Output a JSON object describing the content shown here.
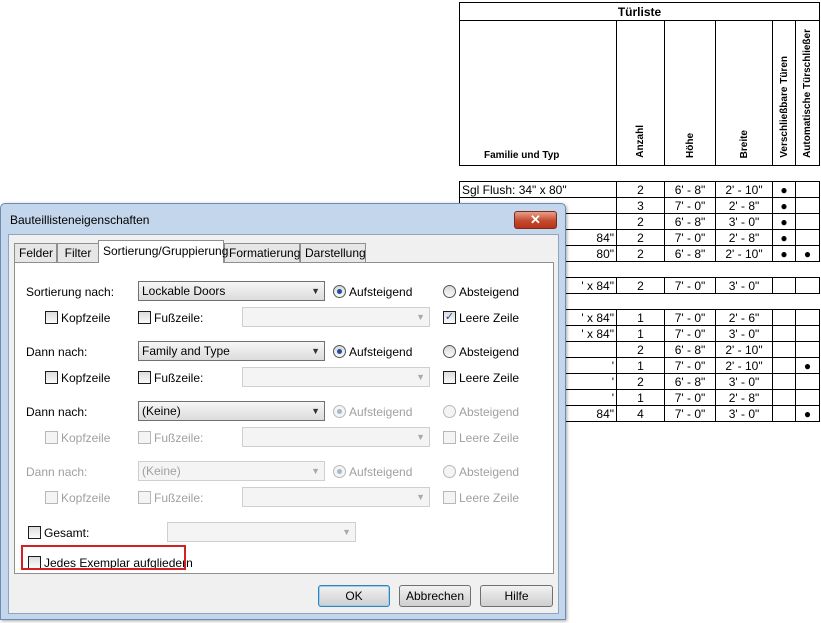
{
  "schedule": {
    "title": "Türliste",
    "headers": {
      "family": "Familie und Typ",
      "count": "Anzahl",
      "height": "Höhe",
      "width": "Breite",
      "lockable": "Verschließbare Türen",
      "auto_closer": "Automatische Türschließer"
    },
    "rows": [
      {
        "gap": true
      },
      {
        "family": "Sgl Flush: 34\" x 80\"",
        "count": "2",
        "height": "6' - 8\"",
        "width": "2' - 10\"",
        "lockable": "●",
        "closer": ""
      },
      {
        "family": "",
        "count": "3",
        "height": "7' - 0\"",
        "width": "2' - 8\"",
        "lockable": "●",
        "closer": ""
      },
      {
        "family": "",
        "count": "2",
        "height": "6' - 8\"",
        "width": "3' - 0\"",
        "lockable": "●",
        "closer": ""
      },
      {
        "family": "84\"",
        "count": "2",
        "height": "7' - 0\"",
        "width": "2' - 8\"",
        "lockable": "●",
        "closer": ""
      },
      {
        "family": "80\"",
        "count": "2",
        "height": "6' - 8\"",
        "width": "2' - 10\"",
        "lockable": "●",
        "closer": "●"
      },
      {
        "gap": true
      },
      {
        "family": "' x 84\"",
        "count": "2",
        "height": "7' - 0\"",
        "width": "3' - 0\"",
        "lockable": "",
        "closer": ""
      },
      {
        "gap": true
      },
      {
        "family": "' x 84\"",
        "count": "1",
        "height": "7' - 0\"",
        "width": "2' - 6\"",
        "lockable": "",
        "closer": ""
      },
      {
        "family": "' x 84\"",
        "count": "1",
        "height": "7' - 0\"",
        "width": "3' - 0\"",
        "lockable": "",
        "closer": ""
      },
      {
        "family": "",
        "count": "2",
        "height": "6' - 8\"",
        "width": "2' - 10\"",
        "lockable": "",
        "closer": ""
      },
      {
        "family": "'",
        "count": "1",
        "height": "7' - 0\"",
        "width": "2' - 10\"",
        "lockable": "",
        "closer": "●"
      },
      {
        "family": "'",
        "count": "2",
        "height": "6' - 8\"",
        "width": "3' - 0\"",
        "lockable": "",
        "closer": ""
      },
      {
        "family": "'",
        "count": "1",
        "height": "7' - 0\"",
        "width": "2' - 8\"",
        "lockable": "",
        "closer": ""
      },
      {
        "family": "84\"",
        "count": "4",
        "height": "7' - 0\"",
        "width": "3' - 0\"",
        "lockable": "",
        "closer": "●"
      }
    ]
  },
  "dialog": {
    "title": "Bauteillisteneigenschaften",
    "close_glyph": "✕",
    "tabs": [
      "Felder",
      "Filter",
      "Sortierung/Gruppierung",
      "Formatierung",
      "Darstellung"
    ],
    "active_tab": "Sortierung/Gruppierung",
    "sort1": {
      "label": "Sortierung nach:",
      "value": "Lockable Doors",
      "asc": "Aufsteigend",
      "desc": "Absteigend",
      "header": "Kopfzeile",
      "footer": "Fußzeile:",
      "blank": "Leere Zeile",
      "blank_checked": true
    },
    "sort2": {
      "label": "Dann nach:",
      "value": "Family and Type",
      "asc": "Aufsteigend",
      "desc": "Absteigend",
      "header": "Kopfzeile",
      "footer": "Fußzeile:",
      "blank": "Leere Zeile"
    },
    "sort3": {
      "label": "Dann nach:",
      "value": "(Keine)",
      "asc": "Aufsteigend",
      "desc": "Absteigend",
      "header": "Kopfzeile",
      "footer": "Fußzeile:",
      "blank": "Leere Zeile"
    },
    "sort4": {
      "label": "Dann nach:",
      "value": "(Keine)",
      "asc": "Aufsteigend",
      "desc": "Absteigend",
      "header": "Kopfzeile",
      "footer": "Fußzeile:",
      "blank": "Leere Zeile"
    },
    "total_label": "Gesamt:",
    "itemize_label": "Jedes Exemplar aufgliedern",
    "check_glyph": "✓",
    "arrow_glyph": "▼",
    "buttons": {
      "ok": "OK",
      "cancel": "Abbrechen",
      "help": "Hilfe"
    },
    "highlight_color": "#d42020"
  }
}
